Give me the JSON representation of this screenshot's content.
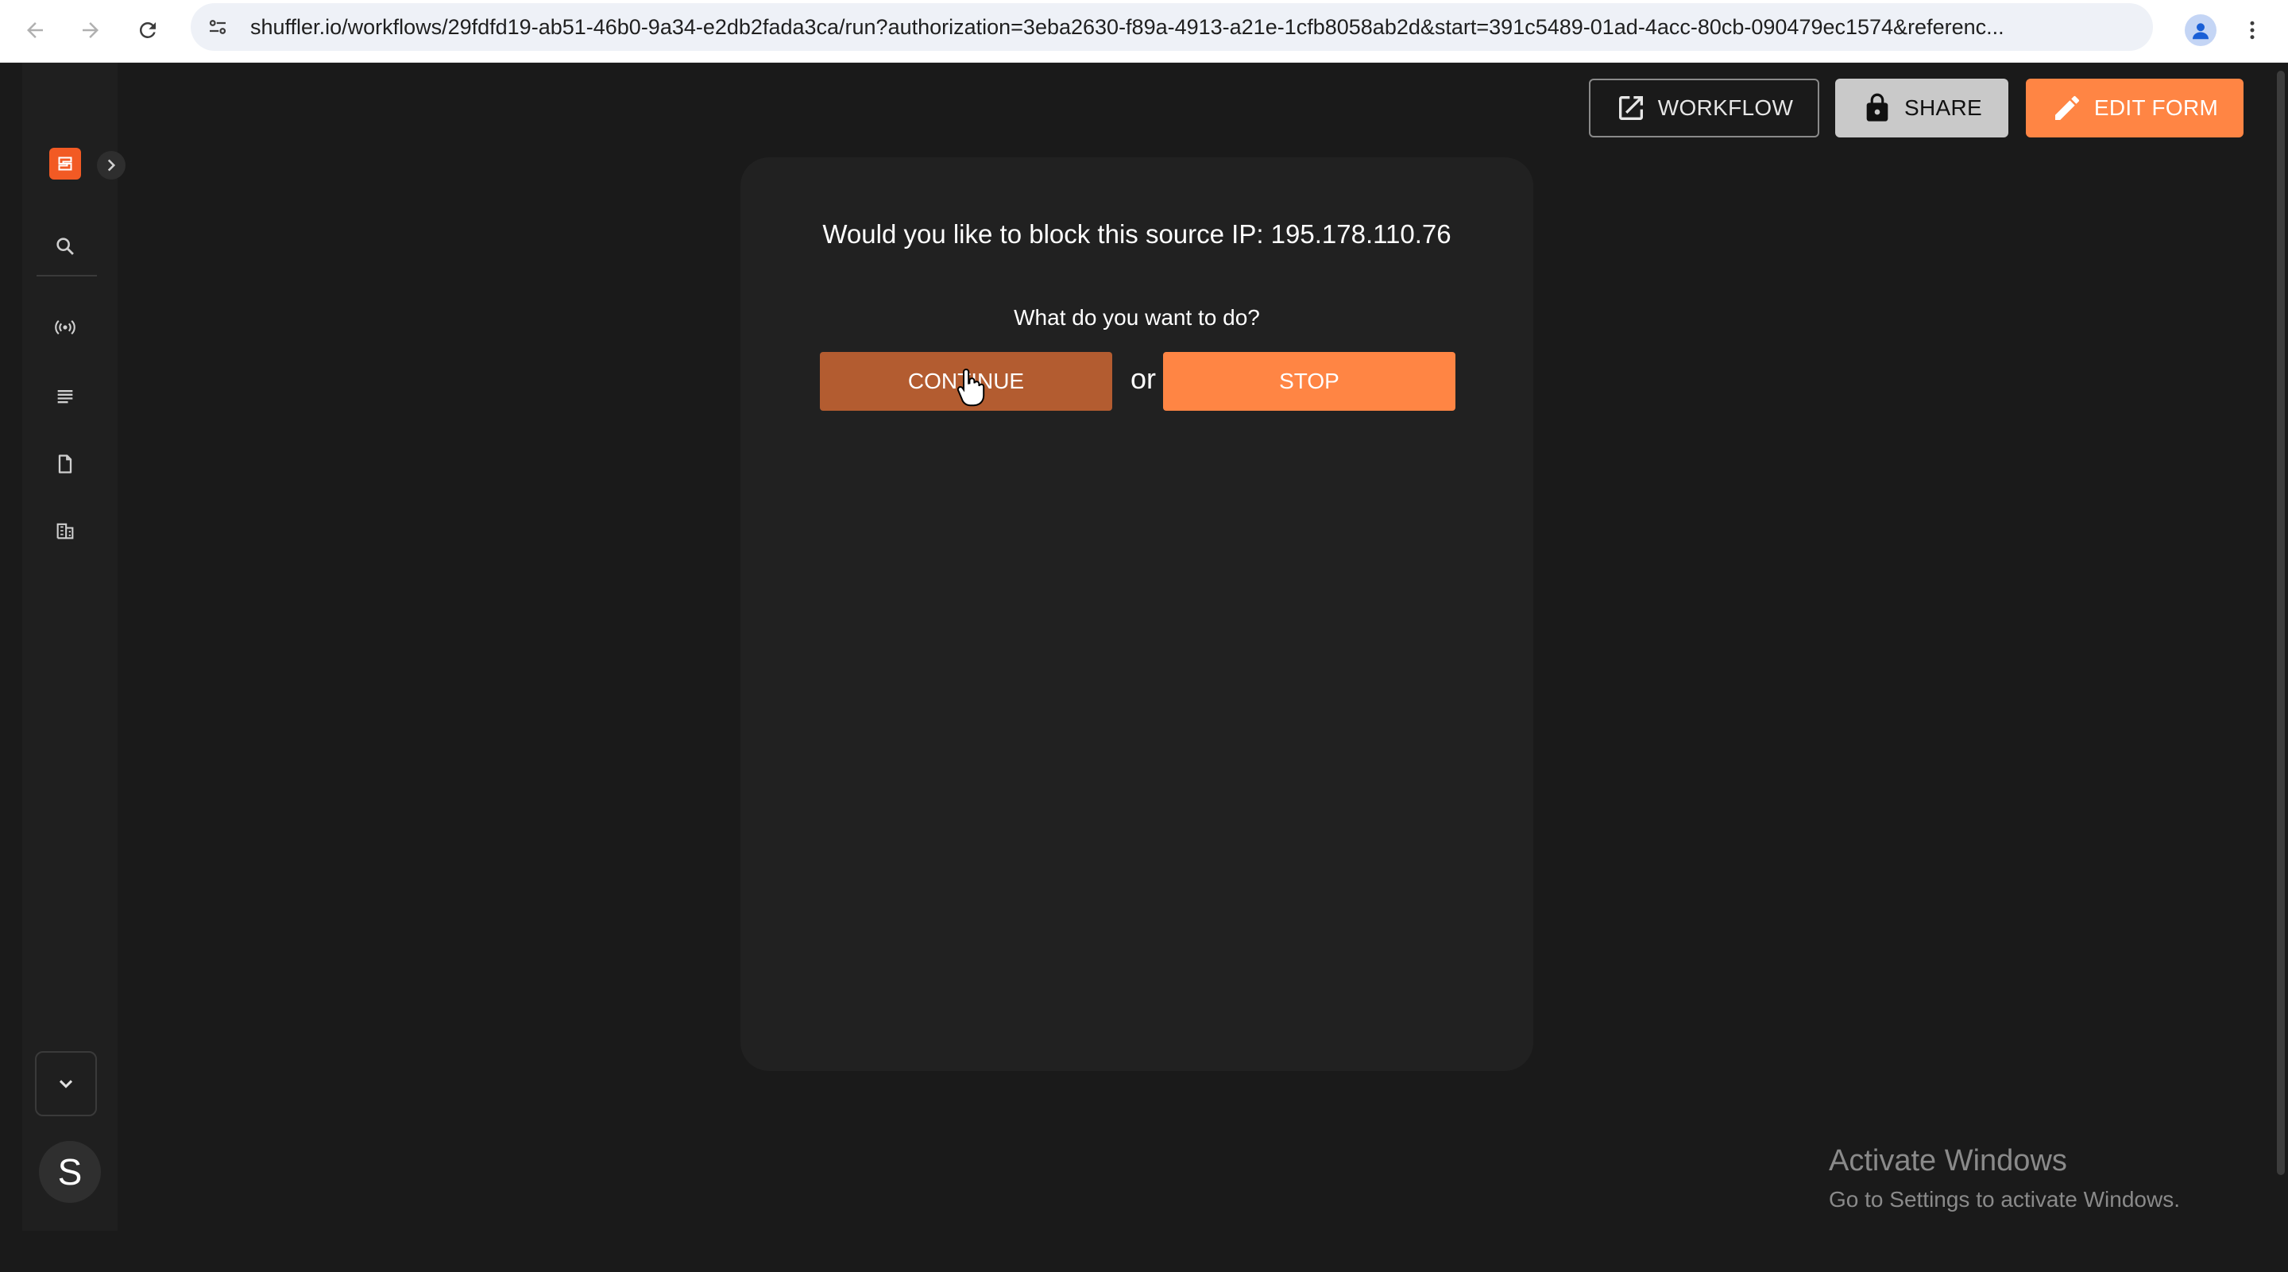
{
  "browser": {
    "url": "shuffler.io/workflows/29fdfd19-ab51-46b0-9a34-e2db2fada3ca/run?authorization=3eba2630-f89a-4913-a21e-1cfb8058ab2d&start=391c5489-01ad-4acc-80cb-090479ec1574&referenc...",
    "icons": [
      "back-icon",
      "forward-icon",
      "reload-icon",
      "site-info-icon",
      "star-icon",
      "profile-icon",
      "more-vert-icon"
    ]
  },
  "header": {
    "workflow_label": "WORKFLOW",
    "share_label": "SHARE",
    "edit_form_label": "EDIT FORM"
  },
  "sidebar": {
    "avatar_letter": "S",
    "icons": [
      "shuffle-logo-icon",
      "chevron-right-icon",
      "search-icon",
      "broadcast-icon",
      "list-icon",
      "document-icon",
      "building-icon",
      "chevron-down-icon"
    ]
  },
  "form": {
    "question": "Would you like to block this source IP: 195.178.110.76",
    "prompt": "What do you want to do?",
    "continue_label": "CONTINUE",
    "or_label": "or",
    "stop_label": "STOP"
  },
  "watermark": {
    "title": "Activate Windows",
    "subtitle": "Go to Settings to activate Windows."
  },
  "colors": {
    "background": "#1a1a1a",
    "card": "#212121",
    "accent_orange": "#ff8544",
    "continue_hover": "#b35c30",
    "logo": "#f25a24"
  }
}
